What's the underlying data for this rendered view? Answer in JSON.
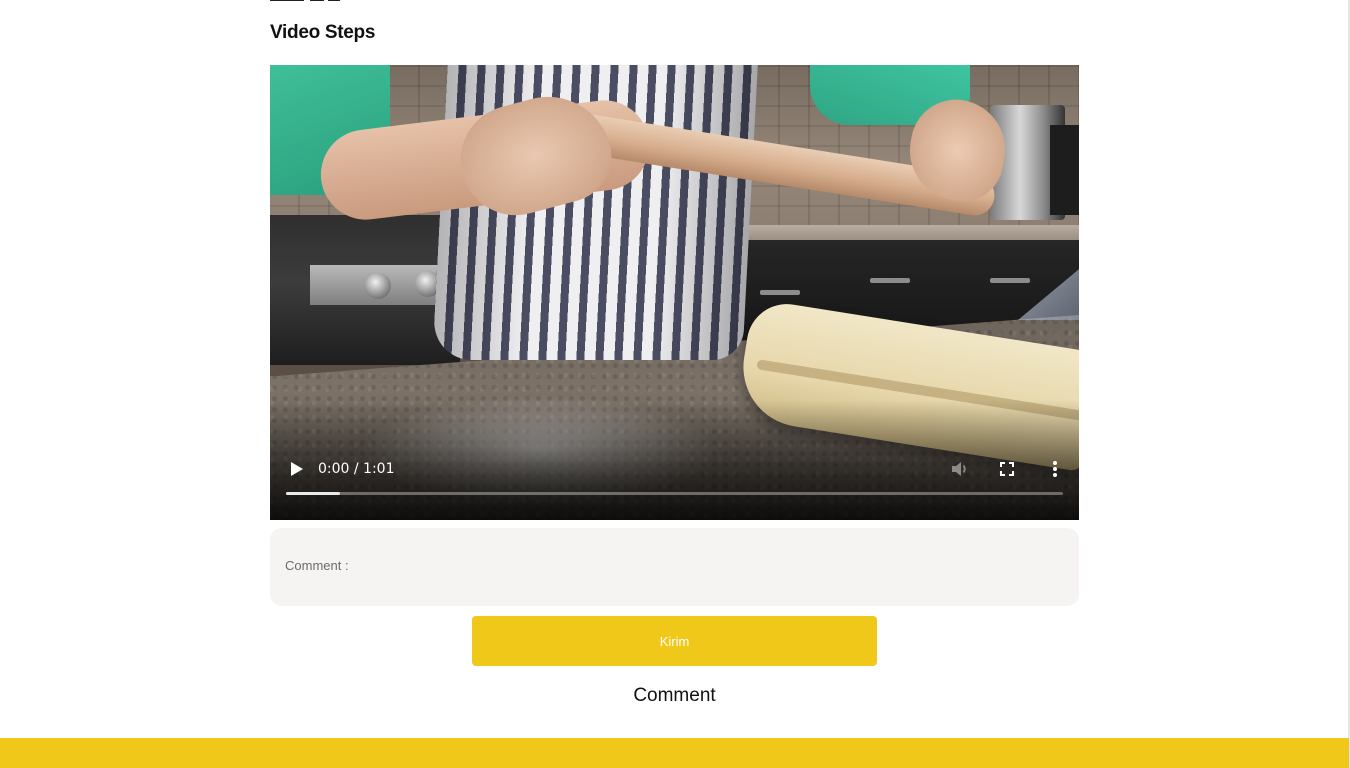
{
  "section": {
    "title": "Video Steps"
  },
  "video": {
    "current_time": "0:00",
    "duration": "1:01",
    "time_display": "0:00 / 1:01",
    "buffered_fraction": 0.07,
    "controls": {
      "play_icon": "play-icon",
      "mute_icon": "volume-icon",
      "fullscreen_icon": "fullscreen-icon",
      "more_icon": "more-vertical-icon"
    }
  },
  "comment_form": {
    "label": "Comment :",
    "value": "",
    "submit_label": "Kirim"
  },
  "comments": {
    "heading": "Comment"
  },
  "colors": {
    "accent": "#f0c81a",
    "input_bg": "#f5f4f2"
  }
}
